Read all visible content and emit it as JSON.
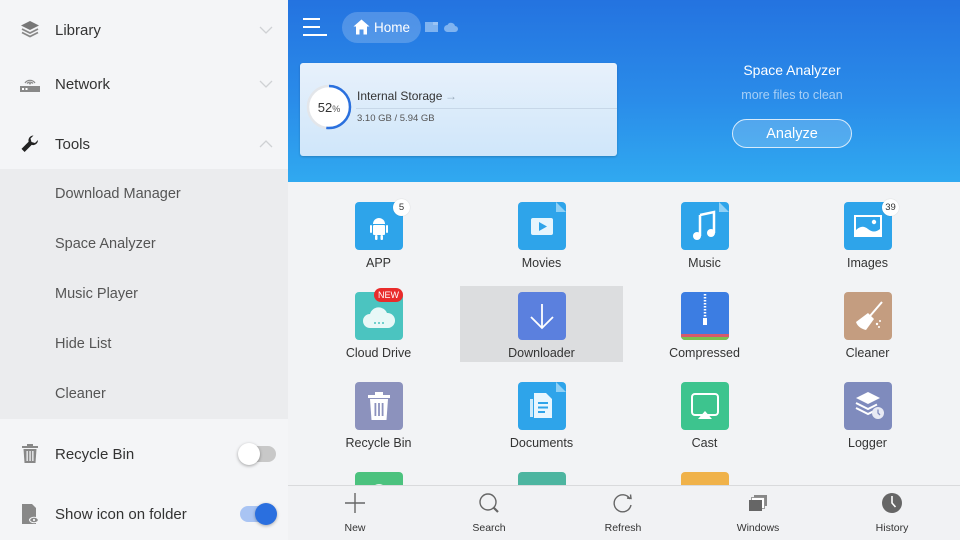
{
  "sidebar": {
    "sections": [
      {
        "label": "Library",
        "icon": "layers-icon",
        "expanded": false
      },
      {
        "label": "Network",
        "icon": "router-icon",
        "expanded": false
      },
      {
        "label": "Tools",
        "icon": "wrench-icon",
        "expanded": true
      }
    ],
    "tools_items": [
      {
        "label": "Download Manager"
      },
      {
        "label": "Space Analyzer"
      },
      {
        "label": "Music Player"
      },
      {
        "label": "Hide List"
      },
      {
        "label": "Cleaner"
      }
    ],
    "settings": [
      {
        "label": "Recycle Bin",
        "icon": "trash-icon",
        "enabled": false
      },
      {
        "label": "Show icon on folder",
        "icon": "file-eye-icon",
        "enabled": true
      }
    ]
  },
  "header": {
    "breadcrumb_home": "Home",
    "storage": {
      "title": "Internal Storage",
      "percent_used": 52,
      "percent_symbol": "%",
      "size_text": "3.10 GB / 5.94 GB"
    },
    "space_analyzer": {
      "title": "Space Analyzer",
      "subtitle": "more files to clean",
      "button_label": "Analyze"
    }
  },
  "grid": {
    "tiles": [
      {
        "label": "APP",
        "icon": "android-icon",
        "color": "#2ea4ea",
        "badge": "5"
      },
      {
        "label": "Movies",
        "icon": "video-file-icon",
        "color": "#2ea4ea"
      },
      {
        "label": "Music",
        "icon": "music-file-icon",
        "color": "#2ea4ea"
      },
      {
        "label": "Images",
        "icon": "image-icon",
        "color": "#2ea4ea",
        "badge": "39"
      },
      {
        "label": "Cloud Drive",
        "icon": "cloud-icon",
        "color": "#4bc4c0",
        "badge_new": "NEW"
      },
      {
        "label": "Downloader",
        "icon": "download-arrow-icon",
        "color": "#5b80de",
        "selected": true
      },
      {
        "label": "Compressed",
        "icon": "zip-icon",
        "color": "#3c7de2"
      },
      {
        "label": "Cleaner",
        "icon": "broom-icon",
        "color": "#c49d80"
      },
      {
        "label": "Recycle Bin",
        "icon": "trash-icon",
        "color": "#8c92bd"
      },
      {
        "label": "Documents",
        "icon": "document-icon",
        "color": "#2ea4ea"
      },
      {
        "label": "Cast",
        "icon": "cast-icon",
        "color": "#3dc48e"
      },
      {
        "label": "Logger",
        "icon": "log-layers-icon",
        "color": "#7f8bbd"
      }
    ],
    "partial_row_colors": [
      "#4cc27e",
      "#4db5a0",
      "#f0b24a"
    ]
  },
  "bottombar": {
    "items": [
      {
        "label": "New",
        "icon": "plus-icon"
      },
      {
        "label": "Search",
        "icon": "search-icon"
      },
      {
        "label": "Refresh",
        "icon": "refresh-icon"
      },
      {
        "label": "Windows",
        "icon": "windows-stack-icon"
      },
      {
        "label": "History",
        "icon": "clock-icon"
      }
    ]
  }
}
